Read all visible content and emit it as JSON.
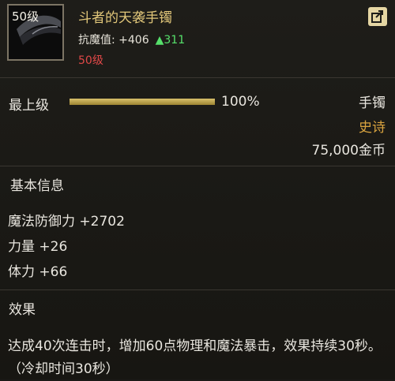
{
  "item": {
    "level_badge": "50级",
    "name": "斗者的天袭手镯",
    "resist_label": "抗魔值: +406",
    "resist_up": "▲311",
    "required_level": "50级"
  },
  "icons": {
    "share": "share-icon",
    "art": "bracelet-art-icon"
  },
  "enhance": {
    "grade": "最上级",
    "percent_text": "100%",
    "fill_fraction": 1.0
  },
  "meta": {
    "slot": "手镯",
    "rarity": "史诗",
    "price": "75,000金币"
  },
  "basic": {
    "title": "基本信息",
    "stats": [
      "魔法防御力 +2702",
      "力量 +26",
      "体力 +66"
    ]
  },
  "effect": {
    "title": "效果",
    "text": "达成40次连击时，增加60点物理和魔法暴击，效果持续30秒。（冷却时间30秒）"
  },
  "colors": {
    "name": "#e2c77a",
    "rarity": "#d9a33f",
    "level_red": "#e04848",
    "up_green": "#56e06b"
  }
}
